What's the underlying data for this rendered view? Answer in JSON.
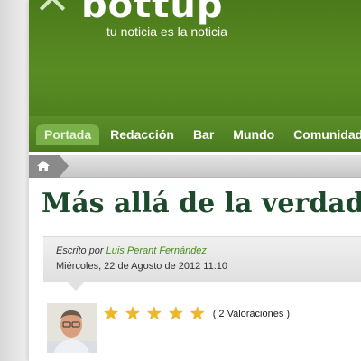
{
  "header": {
    "logo_text": "bottup",
    "tagline": "tu noticia es la noticia"
  },
  "nav": {
    "items": [
      {
        "label": "Portada",
        "active": true
      },
      {
        "label": "Redacción",
        "active": false
      },
      {
        "label": "Bar",
        "active": false
      },
      {
        "label": "Mundo",
        "active": false
      },
      {
        "label": "Comunidad",
        "active": false
      }
    ]
  },
  "article": {
    "title": "Más allá de la verdad o",
    "written_by_label": "Escrito por",
    "author": "Luis Perant Fernández",
    "date": "Miércoles, 22 de Agosto de 2012 11:10",
    "rating": {
      "stars": 5,
      "max_stars": 5,
      "count_text": "( 2 Valoraciones )"
    }
  },
  "colors": {
    "brand_green": "#4f821f",
    "title_green": "#1d4a2c",
    "author_green": "#4a8a1e",
    "star_gold": "#f0b820"
  }
}
